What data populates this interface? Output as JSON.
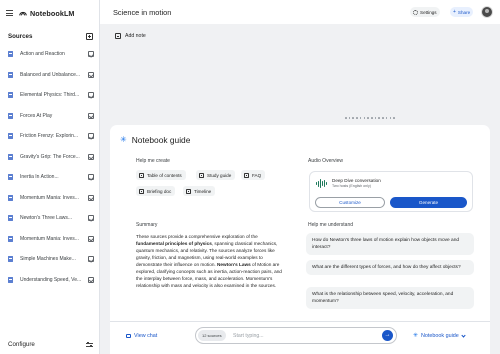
{
  "app": {
    "name": "NotebookLM"
  },
  "notebook": {
    "title": "Science in motion"
  },
  "header": {
    "settings_label": "Settings",
    "share_label": "Share",
    "share_icon": "+"
  },
  "sidebar": {
    "sources_title": "Sources",
    "items": [
      {
        "label": "Action and Reaction"
      },
      {
        "label": "Balanced and Unbalance..."
      },
      {
        "label": "Elemental Physics: Third..."
      },
      {
        "label": "Forces At Play"
      },
      {
        "label": "Friction Frenzy: Explorin..."
      },
      {
        "label": "Gravity's Grip: The Force..."
      },
      {
        "label": "Inertia In Action..."
      },
      {
        "label": "Momentum Mania: Inves..."
      },
      {
        "label": "Newton's Three Laws..."
      },
      {
        "label": "Momentum Mania: Inves..."
      },
      {
        "label": "Simple Machines Make..."
      },
      {
        "label": "Understanding Speed, Ve..."
      }
    ],
    "configure_label": "Configure"
  },
  "notes": {
    "add_note_label": "Add note"
  },
  "guide": {
    "title": "Notebook guide",
    "icon": "✳",
    "help_create_label": "Help me create",
    "create_options": [
      "Table of contents",
      "Study guide",
      "FAQ",
      "Briefing doc",
      "Timeline"
    ],
    "audio": {
      "section_label": "Audio Overview",
      "title": "Deep Dive conversation",
      "subtitle": "Two hosts (English only)",
      "customize_label": "Customize",
      "generate_label": "Generate"
    },
    "summary": {
      "label": "Summary",
      "intro": "These sources provide a comprehensive exploration of the ",
      "bold1": "fundamental principles of physics",
      "mid": ", spanning classical mechanics, quantum mechanics, and relativity. The sources analyze forces like gravity, friction, and magnetism, using real-world examples to demonstrate their influence on motion. ",
      "bold2": "Newton's Laws",
      "outro": " of Motion are explored, clarifying concepts such as inertia, action-reaction pairs, and the interplay between force, mass, and acceleration. Momentum's relationship with mass and velocity is also examined in the sources."
    },
    "understand_label": "Help me understand",
    "questions": [
      "How do Newton's three laws of motion explain how objects move and interact?",
      "What are the different types of forces, and how do they affect objects?",
      "What is the relationship between speed, velocity, acceleration, and momentum?"
    ]
  },
  "chat": {
    "view_chat_label": "View chat",
    "source_count": "12 sources",
    "placeholder": "Start typing...",
    "send_icon": "→",
    "guide_toggle_label": "Notebook guide"
  }
}
